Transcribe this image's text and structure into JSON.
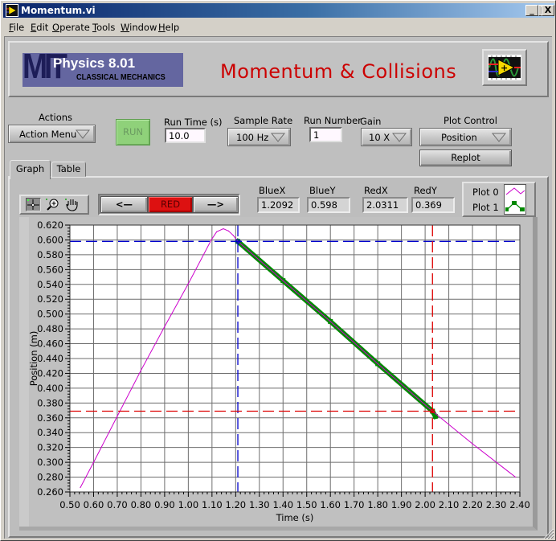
{
  "window": {
    "title": "Momentum.vi",
    "controls": {
      "minimize": "_",
      "maximize": "□",
      "close": "X"
    }
  },
  "menu": {
    "items": [
      "File",
      "Edit",
      "Operate",
      "Tools",
      "Window",
      "Help"
    ]
  },
  "banner": {
    "logo_big": "MIT",
    "logo_title": "Physics 8.01",
    "logo_subtitle": "CLASSICAL MECHANICS",
    "title": "Momentum & Collisions",
    "title_color": "#cc0000",
    "icon": "labview-vi-icon"
  },
  "controls": {
    "actions": {
      "label": "Actions",
      "value": "Action Menu"
    },
    "run_button": {
      "label": "RUN",
      "color": "#8fd17a"
    },
    "run_time": {
      "label": "Run Time (s)",
      "value": "10.0"
    },
    "sample_rate": {
      "label": "Sample Rate",
      "value": "100 Hz"
    },
    "run_number": {
      "label": "Run Number",
      "value": "1"
    },
    "gain": {
      "label": "Gain",
      "value": "10 X"
    },
    "plot_control": {
      "label": "Plot Control",
      "value": "Position"
    },
    "replot_button": {
      "label": "Replot"
    }
  },
  "tabs": [
    {
      "label": "Graph",
      "selected": true
    },
    {
      "label": "Table",
      "selected": false
    }
  ],
  "graph_palette": {
    "tools": [
      "cursor-move-icon",
      "zoom-icon",
      "pan-hand-icon"
    ]
  },
  "cursor_buttons": {
    "prev": "<—",
    "active": "RED",
    "next": "—>",
    "active_color": "#dd1111"
  },
  "cursor_readouts": {
    "blue_x": {
      "label": "BlueX",
      "value": "1.2092"
    },
    "blue_y": {
      "label": "BlueY",
      "value": "0.598"
    },
    "red_x": {
      "label": "RedX",
      "value": "2.0311"
    },
    "red_y": {
      "label": "RedY",
      "value": "0.369"
    }
  },
  "legend": [
    {
      "label": "Plot 0",
      "color": "#cc00cc"
    },
    {
      "label": "Plot 1",
      "color": "#008800"
    }
  ],
  "chart_data": {
    "type": "line",
    "title": "",
    "xlabel": "Time (s)",
    "ylabel": "Position (m)",
    "grid": true,
    "legend": "top-right",
    "x_axis": {
      "range": [
        0.5,
        2.4
      ],
      "ticks": [
        "0.50",
        "0.60",
        "0.70",
        "0.80",
        "0.90",
        "1.00",
        "1.10",
        "1.20",
        "1.30",
        "1.40",
        "1.50",
        "1.60",
        "1.70",
        "1.80",
        "1.90",
        "2.00",
        "2.10",
        "2.20",
        "2.30",
        "2.40"
      ]
    },
    "y_axis": {
      "range": [
        0.26,
        0.62
      ],
      "ticks": [
        "0.260",
        "0.280",
        "0.300",
        "0.320",
        "0.340",
        "0.360",
        "0.380",
        "0.400",
        "0.420",
        "0.440",
        "0.460",
        "0.480",
        "0.500",
        "0.520",
        "0.540",
        "0.560",
        "0.580",
        "0.600",
        "0.620"
      ]
    },
    "series": [
      {
        "name": "Plot 1",
        "color": "#008800",
        "x": [
          1.2092,
          1.4,
          1.6,
          1.8,
          2.0311,
          2.043
        ],
        "y": [
          0.598,
          0.545,
          0.49,
          0.433,
          0.369,
          0.362
        ]
      },
      {
        "name": "Plot 0",
        "color": "#cc00cc",
        "x": [
          0.544,
          0.6,
          0.7,
          0.8,
          0.9,
          1.0,
          1.097,
          1.12,
          1.148,
          1.17,
          1.19,
          1.2092,
          1.4,
          1.6,
          1.8,
          2.0311,
          2.2,
          2.382
        ],
        "y": [
          0.266,
          0.3,
          0.362,
          0.424,
          0.483,
          0.541,
          0.6,
          0.611,
          0.615,
          0.612,
          0.606,
          0.598,
          0.545,
          0.49,
          0.433,
          0.369,
          0.325,
          0.28
        ]
      }
    ],
    "cursors": [
      {
        "name": "Blue",
        "color": "#0000cc",
        "x": 1.2092,
        "y": 0.598
      },
      {
        "name": "Red",
        "color": "#dd0000",
        "x": 2.0311,
        "y": 0.369
      }
    ]
  }
}
